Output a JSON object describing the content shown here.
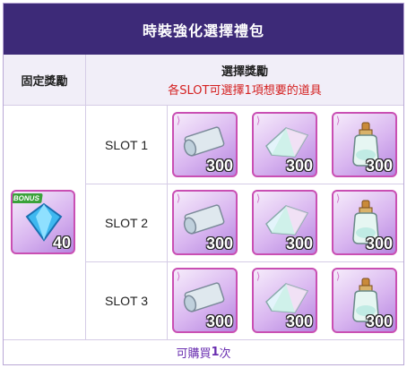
{
  "title": "時裝強化選擇禮包",
  "headers": {
    "fixed": "固定獎勵",
    "select": "選擇獎勵",
    "select_note": "各SLOT可選擇1項想要的道具"
  },
  "fixed_reward": {
    "badge": "BONUS",
    "quantity": "40",
    "icon": "diamond-icon"
  },
  "slots": [
    {
      "label": "SLOT 1",
      "items": [
        {
          "icon": "scroll-icon",
          "quantity": "300"
        },
        {
          "icon": "crystal-icon",
          "quantity": "300"
        },
        {
          "icon": "potion-icon",
          "quantity": "300"
        }
      ]
    },
    {
      "label": "SLOT 2",
      "items": [
        {
          "icon": "scroll-icon",
          "quantity": "300"
        },
        {
          "icon": "crystal-icon",
          "quantity": "300"
        },
        {
          "icon": "potion-icon",
          "quantity": "300"
        }
      ]
    },
    {
      "label": "SLOT 3",
      "items": [
        {
          "icon": "scroll-icon",
          "quantity": "300"
        },
        {
          "icon": "crystal-icon",
          "quantity": "300"
        },
        {
          "icon": "potion-icon",
          "quantity": "300"
        }
      ]
    }
  ],
  "footer": {
    "prefix": "可購買 ",
    "count": "1",
    "suffix": "次"
  },
  "colors": {
    "header_bg": "#3d2a78",
    "note_red": "#d42020",
    "footer_purple": "#6a2fb0"
  }
}
